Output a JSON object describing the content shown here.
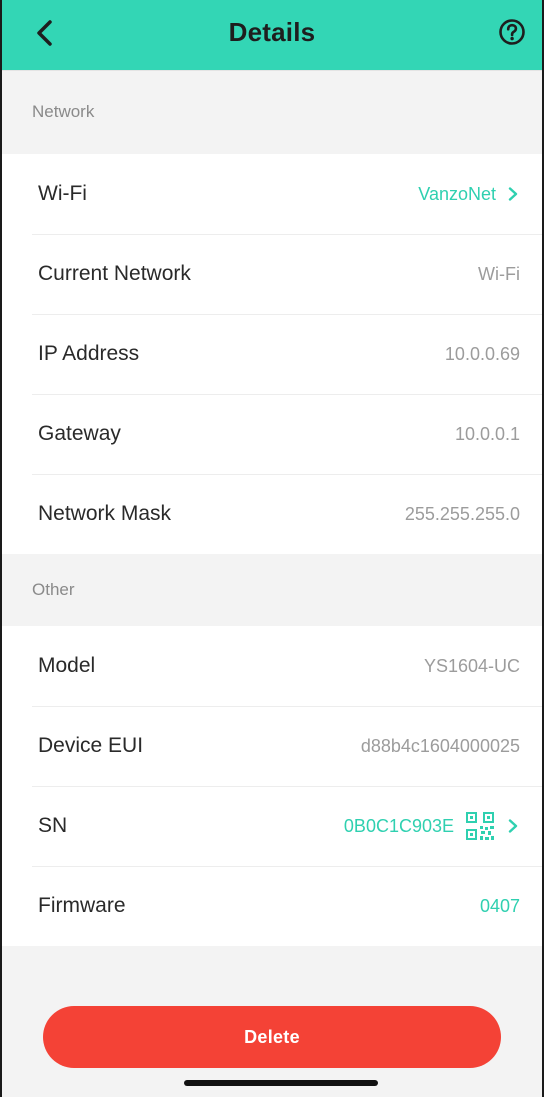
{
  "header": {
    "title": "Details",
    "back_icon": "chevron-left-icon",
    "help_icon": "question-circle-icon",
    "color": "#33d6b5"
  },
  "network": {
    "section_label": "Network",
    "rows": [
      {
        "label": "Wi-Fi",
        "value": "VanzoNet",
        "accent": true,
        "chevron": true
      },
      {
        "label": "Current Network",
        "value": "Wi-Fi"
      },
      {
        "label": "IP Address",
        "value": "10.0.0.69"
      },
      {
        "label": "Gateway",
        "value": "10.0.0.1"
      },
      {
        "label": "Network Mask",
        "value": "255.255.255.0"
      }
    ]
  },
  "other": {
    "section_label": "Other",
    "rows": [
      {
        "label": "Model",
        "value": "YS1604-UC"
      },
      {
        "label": "Device EUI",
        "value": "d88b4c1604000025"
      },
      {
        "label": "SN",
        "value": "0B0C1C903E",
        "accent": true,
        "qr_icon": "qr-code-icon",
        "chevron": true
      },
      {
        "label": "Firmware",
        "value": "0407",
        "accent": true
      }
    ]
  },
  "actions": {
    "delete_label": "Delete",
    "delete_color": "#f44236"
  },
  "accent_color": "#2fd0b0"
}
